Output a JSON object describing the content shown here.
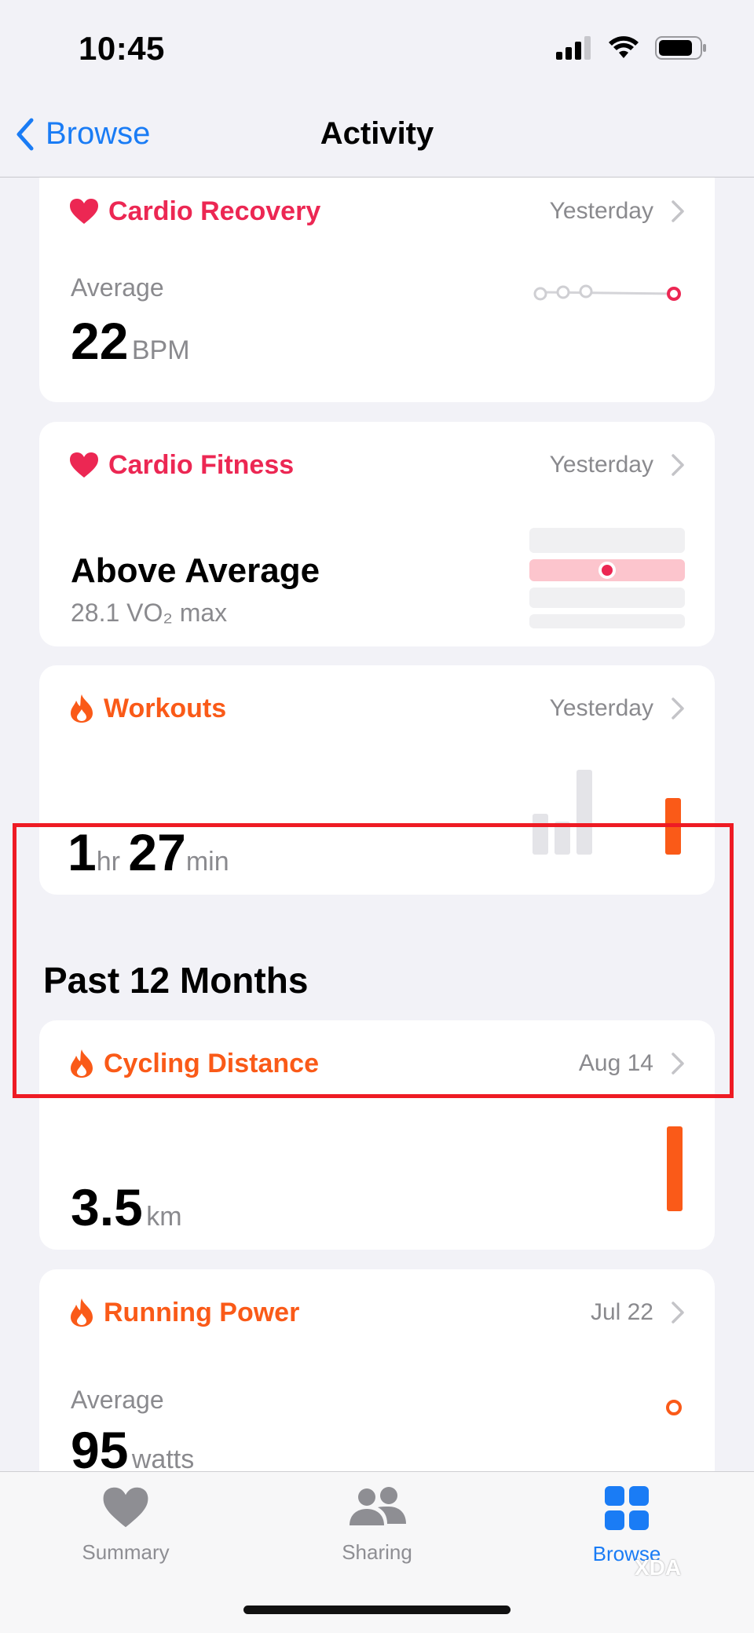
{
  "status_bar": {
    "time": "10:45"
  },
  "nav": {
    "back_label": "Browse",
    "title": "Activity"
  },
  "cards": {
    "cardio_recovery": {
      "title": "Cardio Recovery",
      "date": "Yesterday",
      "label": "Average",
      "value": "22",
      "unit": "BPM"
    },
    "cardio_fitness": {
      "title": "Cardio Fitness",
      "date": "Yesterday",
      "value": "Above Average",
      "detail": "28.1 VO₂ max"
    },
    "workouts": {
      "title": "Workouts",
      "date": "Yesterday",
      "hours": "1",
      "hours_unit": "hr",
      "minutes": "27",
      "minutes_unit": "min"
    },
    "cycling_distance": {
      "title": "Cycling Distance",
      "date": "Aug 14",
      "value": "3.5",
      "unit": "km"
    },
    "running_power": {
      "title": "Running Power",
      "date": "Jul 22",
      "label": "Average",
      "value": "95",
      "unit": "watts"
    }
  },
  "section": {
    "past_12_months": "Past 12 Months"
  },
  "tab_bar": {
    "summary": "Summary",
    "sharing": "Sharing",
    "browse": "Browse",
    "active": "browse"
  },
  "watermark": "XDA",
  "colors": {
    "accent": "#1a7cf5",
    "heart": "#ec2753",
    "activity": "#fa5a18",
    "highlight": "#ee1b24"
  },
  "icons": [
    "heart-icon",
    "flame-icon",
    "chevron-right-icon",
    "back-chevron-icon",
    "signal-icon",
    "wifi-icon",
    "battery-icon",
    "sharing-people-icon",
    "browse-grid-icon"
  ]
}
